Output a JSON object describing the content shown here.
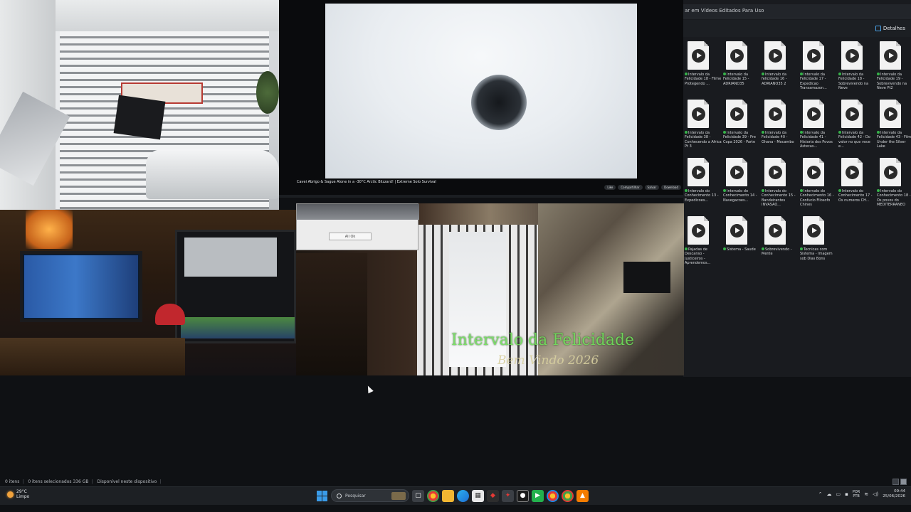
{
  "video": {
    "title": "Cavei Abrigo & Sague Alone in a -30°C Arctic Blizzard! | Extreme Solo Survival",
    "actions": [
      "Like",
      "Compartilhar",
      "Salvar",
      "Download"
    ]
  },
  "explorer": {
    "address": "ar em Vídeos Editados Para Uso",
    "details_label": "Detalhes",
    "files": [
      "Intervalo da Felicidade 18 - Filme Protegendo ...",
      "Intervalo da Felicidade 15 - ADRIANO35",
      "Intervalo da felicidade 16 - ADRIANO35 2",
      "Intervalo da Felicidade 17 - Expedicao Transamazon...",
      "Intervalo da Felicidade 18 - Sobrevivendo na Neve",
      "Intervalo da Felicidade 19 - Sobrevivendo na Neve Pt2",
      "Intervalo da Felicidade 38 - Conhecendo a Africa Pt 3",
      "Intervalo da Felicidade 39 - Pre Copa 2026 - Parte",
      "Intervalo da Felicidade 40 - Ghana - Mocambo",
      "Intervalo da Felicidade 41 - Historia dos Povos Astecas...",
      "Intervalo da Felicidade 42 - Do valor no que voce e...",
      "Intervalo da Felicidade 43 - Filme Under the Silver Lake",
      "Intervalo do Conhecimento 13 - Expedicoes...",
      "Intervalo do Conhecimento 14 - Navegacoes...",
      "Intervalo do Conhecimento 15 - Bandeirantes INVASAO...",
      "Intervalo do Conhecimento 16 - Confucio Filosofo Chines",
      "Intervalo do Conhecimento 17 - Os numeros CH...",
      "Intervalo do Conhecimento 18 - Os povos do MEDITERRANEO",
      "Pajadas de Descanso - Justiceiros - Aprendemos...",
      "Sistema - Saude",
      "Sobrevivendo - Mente",
      "Tecnicas com Sistema - Imagem sob Dias Bons"
    ]
  },
  "dialog_button": "All Ok",
  "overlay": {
    "title": "Intervalo da Felicidade",
    "subtitle": "Bem Vindo 2026"
  },
  "status": {
    "items": "0 itens",
    "selected": "0 itens selecionados 336 GB",
    "availability": "Disponível neste dispositivo"
  },
  "taskbar": {
    "temperature": "29°C",
    "condition": "Limpo",
    "search_placeholder": "Pesquisar",
    "lang_top": "POR",
    "lang_bottom": "PTB",
    "time": "09:44",
    "date": "25/06/2026"
  }
}
